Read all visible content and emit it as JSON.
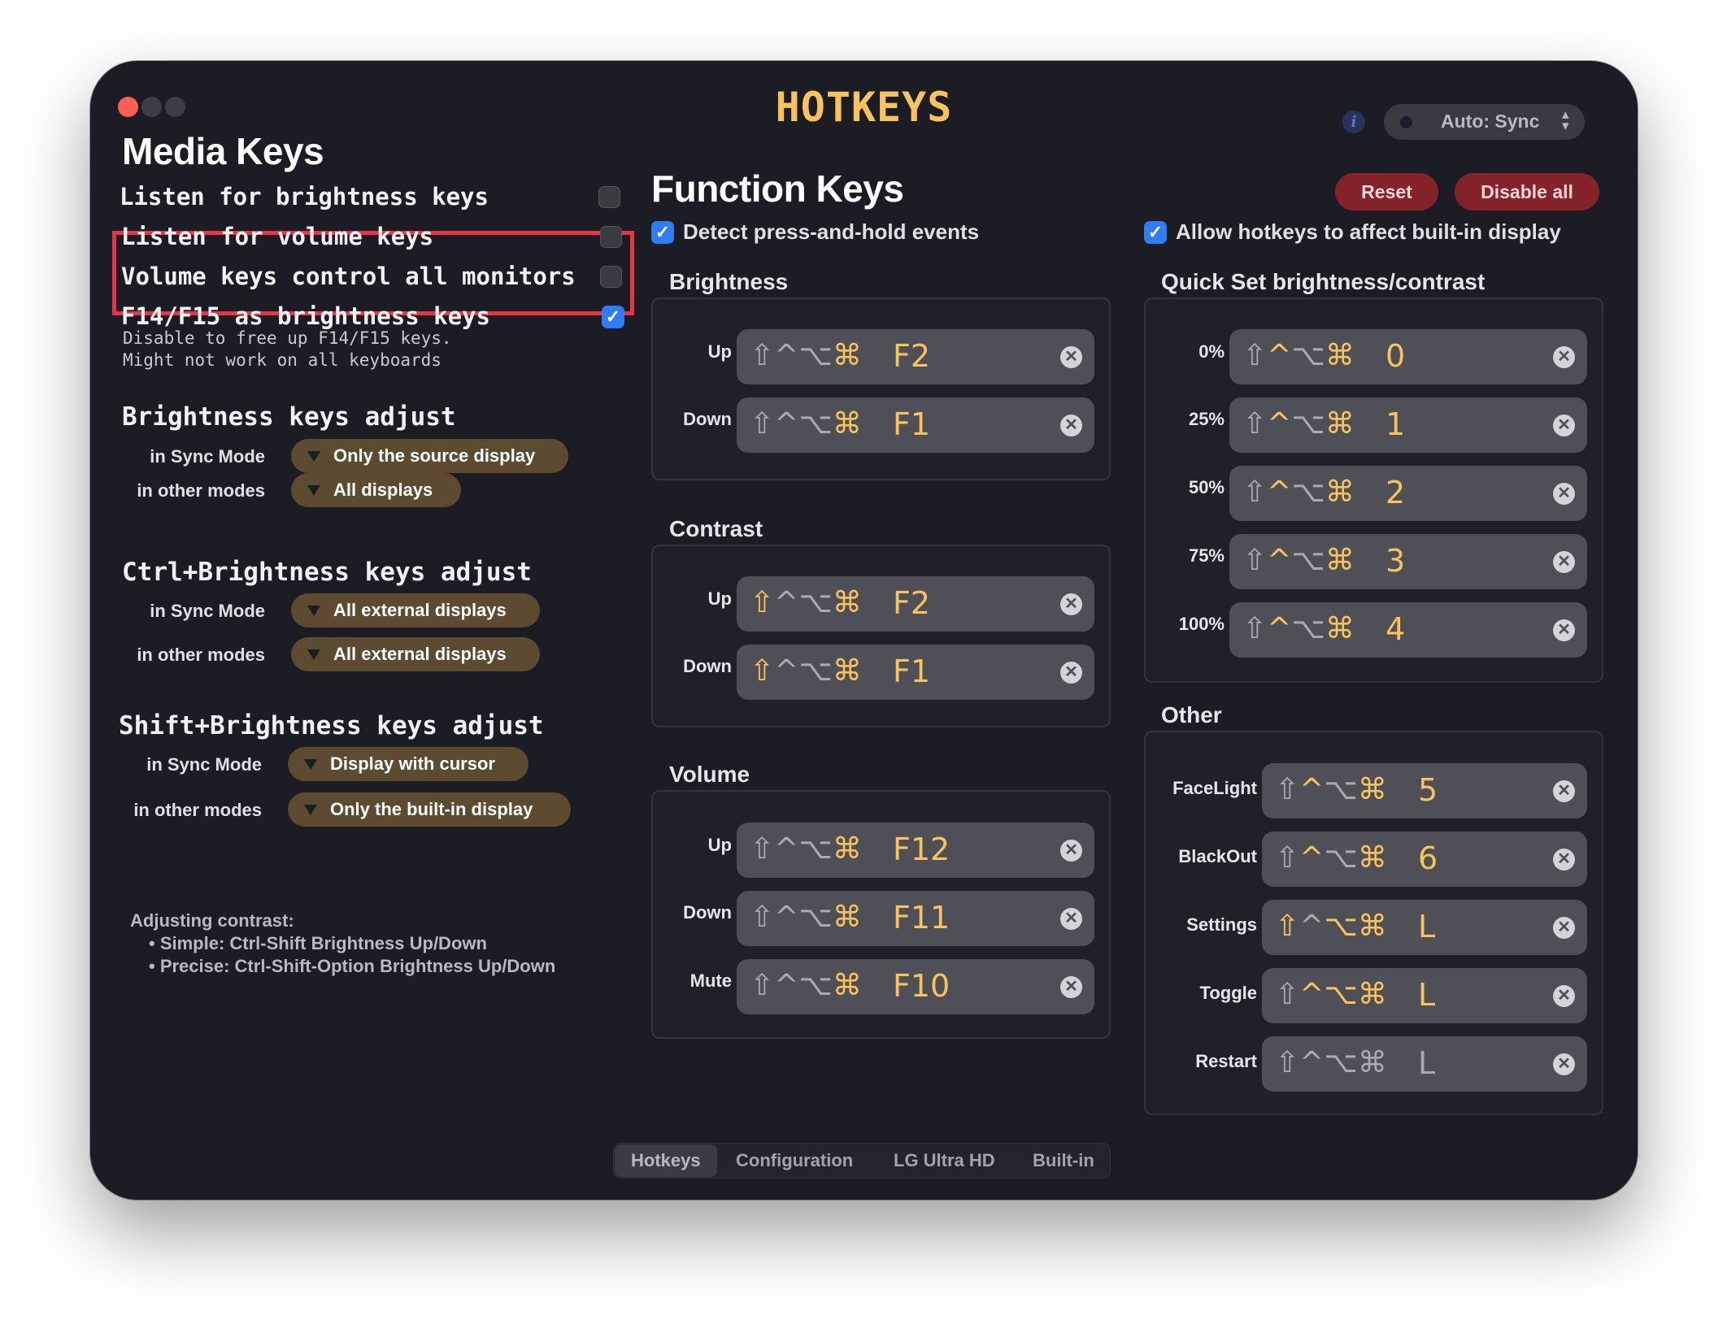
{
  "window": {
    "title": "HOTKEYS",
    "sync_mode": "Auto: Sync",
    "info_label": "i"
  },
  "media": {
    "title": "Media Keys",
    "options": [
      {
        "label": "Listen for brightness keys",
        "checked": false
      },
      {
        "label": "Listen for volume keys",
        "checked": false
      },
      {
        "label": "Volume keys control all monitors",
        "checked": false
      },
      {
        "label": "F14/F15 as brightness keys",
        "checked": true,
        "desc1": "Disable to free up F14/F15 keys.",
        "desc2": "Might not work on all keyboards"
      }
    ],
    "sections": [
      {
        "title": "Brightness keys adjust",
        "sync_label": "in Sync Mode",
        "sync_value": "Only the source display",
        "other_label": "in other modes",
        "other_value": "All displays"
      },
      {
        "title": "Ctrl+Brightness keys adjust",
        "sync_label": "in Sync Mode",
        "sync_value": "All external displays",
        "other_label": "in other modes",
        "other_value": "All external displays"
      },
      {
        "title": "Shift+Brightness keys adjust",
        "sync_label": "in Sync Mode",
        "sync_value": "Display with cursor",
        "other_label": "in other modes",
        "other_value": "Only the built-in display"
      }
    ],
    "note": {
      "title": "Adjusting contrast:",
      "line1": "• Simple:  Ctrl-Shift Brightness Up/Down",
      "line2": "• Precise: Ctrl-Shift-Option Brightness Up/Down"
    }
  },
  "function": {
    "title": "Function Keys",
    "detect_hold": {
      "label": "Detect press-and-hold events",
      "checked": true
    },
    "allow_builtin": {
      "label": "Allow hotkeys to affect built-in display",
      "checked": true
    },
    "reset_label": "Reset",
    "disable_all_label": "Disable all",
    "brightness": {
      "title": "Brightness",
      "up": "Up",
      "up_key": "F2",
      "down": "Down",
      "down_key": "F1"
    },
    "contrast": {
      "title": "Contrast",
      "up": "Up",
      "up_key": "F2",
      "down": "Down",
      "down_key": "F1"
    },
    "volume": {
      "title": "Volume",
      "up": "Up",
      "up_key": "F12",
      "down": "Down",
      "down_key": "F11",
      "mute": "Mute",
      "mute_key": "F10"
    },
    "quickset": {
      "title": "Quick Set brightness/contrast",
      "rows": [
        {
          "label": "0%",
          "key": "0"
        },
        {
          "label": "25%",
          "key": "1"
        },
        {
          "label": "50%",
          "key": "2"
        },
        {
          "label": "75%",
          "key": "3"
        },
        {
          "label": "100%",
          "key": "4"
        }
      ]
    },
    "other": {
      "title": "Other",
      "rows": [
        {
          "label": "FaceLight",
          "key": "5"
        },
        {
          "label": "BlackOut",
          "key": "6"
        },
        {
          "label": "Settings",
          "key": "L"
        },
        {
          "label": "Toggle",
          "key": "L"
        },
        {
          "label": "Restart",
          "key": "L"
        }
      ]
    }
  },
  "mod_symbols": {
    "shift": "⇧",
    "ctrl": "^",
    "option": "⌥",
    "cmd": "⌘"
  },
  "clear_symbol": "✕",
  "tabs": [
    "Hotkeys",
    "Configuration",
    "LG Ultra HD",
    "Built-in"
  ],
  "colors": {
    "accent": "#f8c35c",
    "danger": "#85232a",
    "checkbox_on": "#2f7cf6",
    "highlight": "#ea3346"
  }
}
